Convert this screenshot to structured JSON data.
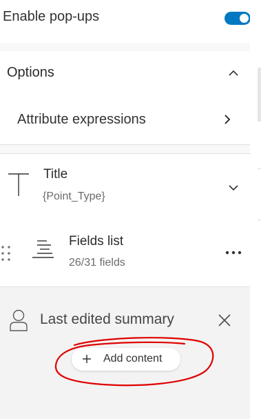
{
  "popups": {
    "label": "Enable pop-ups",
    "enabled": true
  },
  "options": {
    "header_label": "Options",
    "attribute_expressions_label": "Attribute expressions"
  },
  "title_element": {
    "label": "Title",
    "value": "{Point_Type}"
  },
  "fields_list": {
    "label": "Fields list",
    "count_text": "26/31 fields"
  },
  "summary": {
    "label": "Last edited summary",
    "add_content_label": "Add content"
  },
  "icons": {
    "toggle": "toggle-switch",
    "options_collapse": "chevron-up-icon",
    "attr_open": "chevron-right-icon",
    "title": "text-title-icon",
    "title_expand": "chevron-down-icon",
    "drag": "drag-handle-icon",
    "fields": "fields-list-icon",
    "more": "more-options-icon",
    "user": "user-icon",
    "close": "close-icon",
    "add": "plus-icon"
  },
  "colors": {
    "accent": "#0079c1",
    "annotation": "#e00000"
  }
}
